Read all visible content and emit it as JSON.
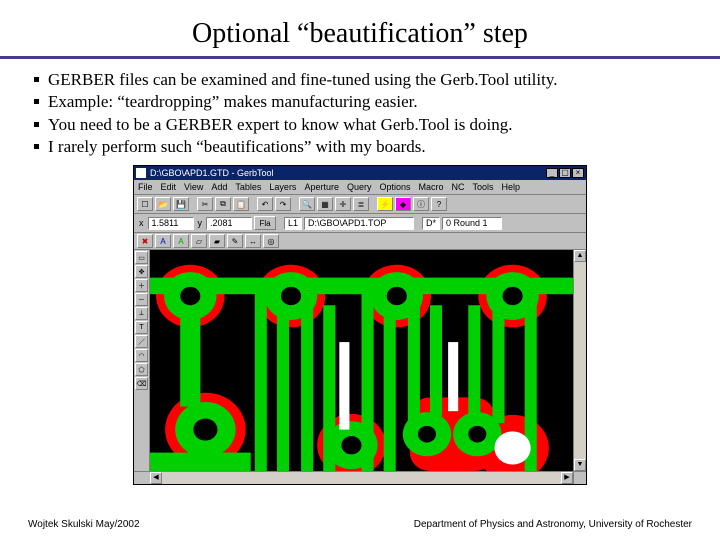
{
  "title": "Optional “beautification” step",
  "bullets": [
    "GERBER files can be examined and fine-tuned using the Gerb.Tool utility.",
    "Example: “teardropping” makes manufacturing easier.",
    "You need to be a GERBER expert to know what Gerb.Tool is doing.",
    "I rarely perform such “beautifications” with my boards."
  ],
  "app": {
    "title": "D:\\GBO\\APD1.GTD - GerbTool",
    "menus": [
      "File",
      "Edit",
      "View",
      "Add",
      "Tables",
      "Layers",
      "Aperture",
      "Query",
      "Options",
      "Macro",
      "NC",
      "Tools",
      "Help"
    ],
    "toolbar1": {
      "icons": [
        "new",
        "open",
        "save",
        "|",
        "cut",
        "copy",
        "paste",
        "|",
        "undo",
        "redo",
        "|",
        "zoom",
        "grid",
        "snap",
        "layer",
        "|",
        "help",
        "about"
      ]
    },
    "toolbar2": {
      "coord_x_label": "x",
      "coord_x": "1.5811",
      "coord_y_label": "y",
      "coord_y": ".2081",
      "flash_btn": "Fla",
      "layer_label": "L1",
      "file_label": "D:\\GBO\\APD1.TOP",
      "dcode_label": "D*",
      "aperture_label": "0 Round 1"
    },
    "side_icons": [
      "sel",
      "pan",
      "zoom+",
      "zoom-",
      "meas",
      "text",
      "line",
      "arc",
      "poly",
      "del"
    ]
  },
  "footer": {
    "left": "Wojtek Skulski  May/2002",
    "right": "Department of Physics and Astronomy, University of Rochester"
  }
}
